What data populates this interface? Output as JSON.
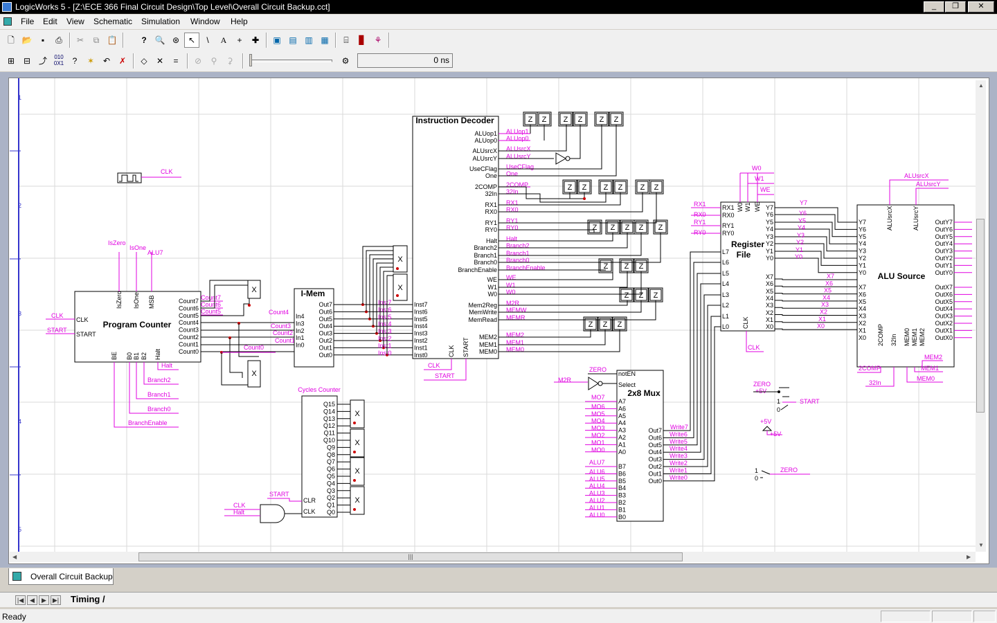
{
  "window": {
    "title": "LogicWorks 5 - [Z:\\ECE 366 Final Circuit Design\\Top Level\\Overall Circuit Backup.cct]",
    "minimize": "_",
    "restore": "❐",
    "close": "✕"
  },
  "menu": [
    "File",
    "Edit",
    "View",
    "Schematic",
    "Simulation",
    "Window",
    "Help"
  ],
  "toolbar1": [
    "new-icon",
    "open-icon",
    "save-icon",
    "print-icon",
    "cut-icon",
    "copy-icon",
    "paste-icon",
    "help-icon",
    "zoom-icon",
    "zoom-help-icon",
    "pointer-icon",
    "pen-icon",
    "text-icon",
    "crosshair-icon",
    "add-icon",
    "part-palette-icon",
    "part-icon-2",
    "part-icon-3",
    "part-icon-4",
    "device-icon",
    "chart-icon",
    "network-icon"
  ],
  "toolbar2": [
    "fit-icon",
    "fit-2-icon",
    "route-icon",
    "binary-icon",
    "probe-icon",
    "star-icon",
    "undo-icon",
    "delete-icon",
    "diamond-icon",
    "x-icon",
    "equals-icon",
    "reset-icon",
    "step-icon",
    "run-icon",
    "speed-icon"
  ],
  "sim": {
    "time": "0 ns"
  },
  "rulers": [
    "1",
    "2",
    "3",
    "4",
    "5"
  ],
  "colors": {
    "wire": "#000000",
    "label": "#e000e0",
    "junction": "#cc0000"
  },
  "components": {
    "instruction_decoder": {
      "title": "Instruction Decoder",
      "outputs": [
        "ALUop1",
        "ALUop0",
        "ALUsrcX",
        "ALUsrcY",
        "UseCFlag",
        "One",
        "2COMP",
        "32In",
        "RX1",
        "RX0",
        "RY1",
        "RY0",
        "Halt",
        "Branch2",
        "Branch1",
        "Branch0",
        "BranchEnable",
        "WE",
        "W1",
        "W0",
        "Mem2Reg",
        "MemWrite",
        "MemRead",
        "MEM2",
        "MEM1",
        "MEM0"
      ],
      "inputs": [
        "Inst7",
        "Inst6",
        "Inst5",
        "Inst4",
        "Inst3",
        "Inst2",
        "Inst1",
        "Inst0"
      ],
      "bottom": [
        "CLK",
        "START"
      ]
    },
    "program_counter": {
      "title": "Program Counter",
      "left": [
        "CLK",
        "START"
      ],
      "top": [
        "IsZero",
        "IsOne",
        "MSB"
      ],
      "right": [
        "Count7",
        "Count6",
        "Count5",
        "Count4",
        "Count3",
        "Count2",
        "Count1",
        "Count0"
      ],
      "bottom": [
        "BE",
        "B0",
        "B1",
        "B2",
        "Halt"
      ]
    },
    "imem": {
      "title": "I-Mem",
      "inputs": [
        "In4",
        "In3",
        "In2",
        "In1",
        "In0"
      ],
      "outputs": [
        "Out7",
        "Out6",
        "Out5",
        "Out4",
        "Out3",
        "Out2",
        "Out1",
        "Out0"
      ]
    },
    "register_file": {
      "title_line1": "Register",
      "title_line2": "File",
      "top": [
        "W0",
        "W1",
        "WE"
      ],
      "left": [
        "RX1",
        "RX0",
        "RY1",
        "RY0",
        "L7",
        "L6",
        "L5",
        "L4",
        "L3",
        "L2",
        "L1",
        "L0"
      ],
      "right_y": [
        "Y7",
        "Y6",
        "Y5",
        "Y4",
        "Y3",
        "Y2",
        "Y1",
        "Y0"
      ],
      "right_x": [
        "X7",
        "X6",
        "X5",
        "X4",
        "X3",
        "X2",
        "X1",
        "X0"
      ],
      "bottom": [
        "CLK"
      ]
    },
    "alu_source": {
      "title": "ALU Source",
      "top": [
        "ALUsrcX",
        "ALUsrcY"
      ],
      "left_y": [
        "Y7",
        "Y6",
        "Y5",
        "Y4",
        "Y3",
        "Y2",
        "Y1",
        "Y0"
      ],
      "left_x": [
        "X7",
        "X6",
        "X5",
        "X4",
        "X3",
        "X2",
        "X1",
        "X0"
      ],
      "right_y": [
        "OutY7",
        "OutY6",
        "OutY5",
        "OutY4",
        "OutY3",
        "OutY2",
        "OutY1",
        "OutY0"
      ],
      "right_x": [
        "OutX7",
        "OutX6",
        "OutX5",
        "OutX4",
        "OutX3",
        "OutX2",
        "OutX1",
        "OutX0"
      ],
      "bottom": [
        "2COMP",
        "32In",
        "MEM0",
        "MEM1",
        "MEM2"
      ]
    },
    "mux": {
      "title": "2x8 Mux",
      "top": [
        "notEN",
        "Select"
      ],
      "a": [
        "A7",
        "A6",
        "A5",
        "A4",
        "A3",
        "A2",
        "A1",
        "A0"
      ],
      "b": [
        "B7",
        "B6",
        "B5",
        "B4",
        "B3",
        "B2",
        "B1",
        "B0"
      ],
      "out": [
        "Out7",
        "Out6",
        "Out5",
        "Out4",
        "Out3",
        "Out2",
        "Out1",
        "Out0"
      ]
    },
    "cycles_counter": {
      "title": "Cycles Counter",
      "outputs": [
        "Q15",
        "Q14",
        "Q13",
        "Q12",
        "Q11",
        "Q10",
        "Q9",
        "Q8",
        "Q7",
        "Q6",
        "Q5",
        "Q4",
        "Q3",
        "Q2",
        "Q1",
        "Q0"
      ],
      "inputs": [
        "CLR",
        "CLK"
      ]
    }
  },
  "labels": {
    "clock": "CLK",
    "pc_left": [
      "CLK",
      "START"
    ],
    "pc_top": [
      "IsZero",
      "IsOne",
      "ALU7"
    ],
    "pc_right": [
      "Count7",
      "Count6",
      "Count5"
    ],
    "pc_bottom": [
      "Halt",
      "Branch2",
      "Branch1",
      "Branch0",
      "BranchEnable"
    ],
    "imem_in": [
      "Count4",
      "Count3",
      "Count2",
      "Count1"
    ],
    "count0": "Count0",
    "inst": [
      "Inst7",
      "Inst6",
      "Inst5",
      "Inst4",
      "Inst3",
      "Inst2",
      "Inst1",
      "Inst0"
    ],
    "dec_out": [
      "ALUop1",
      "ALUop0",
      "ALUsrcX",
      "ALUsrcY",
      "UseCFlag",
      "One",
      "2COMP",
      "32In",
      "RX1",
      "RX0",
      "RY1",
      "RY0",
      "Halt",
      "Branch2",
      "Branch1",
      "Branch0",
      "BranchEnable",
      "WE",
      "W1",
      "W0",
      "M2R",
      "MEMW",
      "MEMR",
      "MEM2",
      "MEM1",
      "MEM0"
    ],
    "dec_bottom": [
      "CLK",
      "START"
    ],
    "rf_top": [
      "W0",
      "W1",
      "WE"
    ],
    "rf_left": [
      "RX1",
      "RX0",
      "RY1",
      "RY0"
    ],
    "rf_y": [
      "Y7",
      "Y6",
      "Y5",
      "Y4",
      "Y3",
      "Y2",
      "Y1",
      "Y0"
    ],
    "rf_x": [
      "X7",
      "X6",
      "X5",
      "X4",
      "X3",
      "X2",
      "X1",
      "X0"
    ],
    "rf_clk": "CLK",
    "alu_top": [
      "ALUsrcX",
      "ALUsrcY"
    ],
    "alu_bottom": [
      "2COMP",
      "32In",
      "MEM2",
      "MEM1",
      "MEM0"
    ],
    "mux_sel": [
      "ZERO",
      "M2R"
    ],
    "mux_a": [
      "MO7",
      "MO6",
      "MO5",
      "MO4",
      "MO3",
      "MO2",
      "MO1",
      "MO0"
    ],
    "mux_b": [
      "ALU7",
      "ALU6",
      "ALU5",
      "ALU4",
      "ALU3",
      "ALU2",
      "ALU1",
      "ALU0"
    ],
    "write": [
      "Write7",
      "Write6",
      "Write5",
      "Write4",
      "Write3",
      "Write2",
      "Write1",
      "Write0"
    ],
    "switch1": [
      "ZERO",
      "+5V",
      "START"
    ],
    "switch1_states": [
      "1",
      "0"
    ],
    "vsource": [
      "+5V",
      "+5V"
    ],
    "switch2": [
      "ZERO"
    ],
    "switch2_states": [
      "1",
      "0"
    ],
    "cc_in": [
      "START",
      "CLK",
      "Halt"
    ]
  },
  "probes": {
    "z": "Z",
    "x": "X"
  },
  "tab": {
    "label": "Overall Circuit Backup"
  },
  "timing": {
    "label": "Timing /",
    "nav": [
      "|◀",
      "◀",
      "▶",
      "▶|"
    ]
  },
  "status": {
    "text": "Ready"
  }
}
